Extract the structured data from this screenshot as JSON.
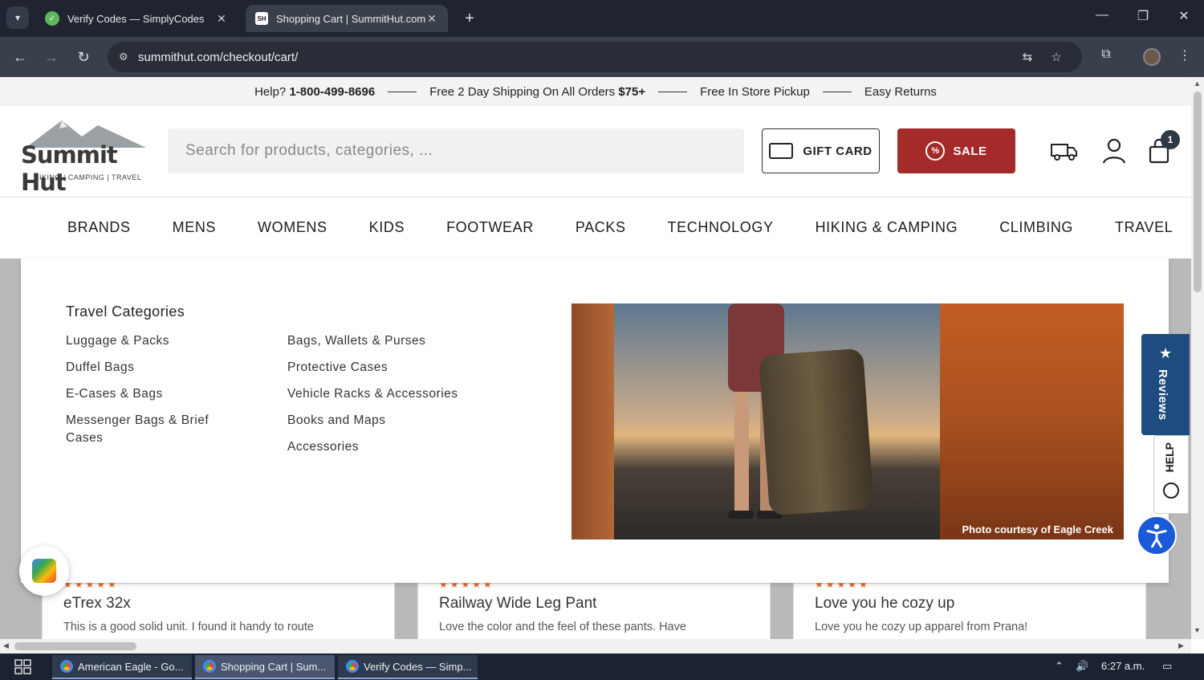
{
  "browser": {
    "tabs": [
      {
        "title": "Verify Codes — SimplyCodes",
        "active": false
      },
      {
        "title": "Shopping Cart | SummitHut.com",
        "active": true
      }
    ],
    "url": "summithut.com/checkout/cart/"
  },
  "promo": {
    "help_prefix": "Help?",
    "phone": "1-800-499-8696",
    "shipping_text": "Free 2 Day Shipping On All Orders",
    "shipping_amount": "$75+",
    "pickup": "Free In Store Pickup",
    "returns": "Easy Returns"
  },
  "header": {
    "logo_name": "Summit Hut",
    "logo_tagline": "HIKING | CAMPING | TRAVEL",
    "search_placeholder": "Search for products, categories, ...",
    "gift_card_label": "GIFT CARD",
    "sale_label": "SALE",
    "cart_count": "1"
  },
  "nav": {
    "items": [
      "BRANDS",
      "MENS",
      "WOMENS",
      "KIDS",
      "FOOTWEAR",
      "PACKS",
      "TECHNOLOGY",
      "HIKING & CAMPING",
      "CLIMBING",
      "TRAVEL"
    ]
  },
  "mega_menu": {
    "heading": "Travel Categories",
    "col1": [
      "Luggage & Packs",
      "Duffel Bags",
      "E-Cases & Bags",
      "Messenger Bags & Brief Cases"
    ],
    "col2": [
      "Bags, Wallets & Purses",
      "Protective Cases",
      "Vehicle Racks & Accessories",
      "Books and Maps",
      "Accessories"
    ],
    "photo_credit": "Photo courtesy of Eagle Creek"
  },
  "review_cards": [
    {
      "title": "eTrex 32x",
      "text": "This is a good solid unit. I found it handy to route"
    },
    {
      "title": "Railway Wide Leg Pant",
      "text": "Love the color and the feel of these pants. Have"
    },
    {
      "title": "Love you he cozy up",
      "text": "Love you he cozy up apparel from Prana!"
    }
  ],
  "widgets": {
    "reviews_label": "Reviews",
    "help_label": "HELP"
  },
  "taskbar": {
    "items": [
      "American Eagle - Go...",
      "Shopping Cart | Sum...",
      "Verify Codes — Simp..."
    ],
    "time": "6:27 a.m."
  },
  "colors": {
    "sale": "#a52a2a",
    "reviews": "#1e4c7e",
    "accessibility": "#1a5ad7"
  }
}
